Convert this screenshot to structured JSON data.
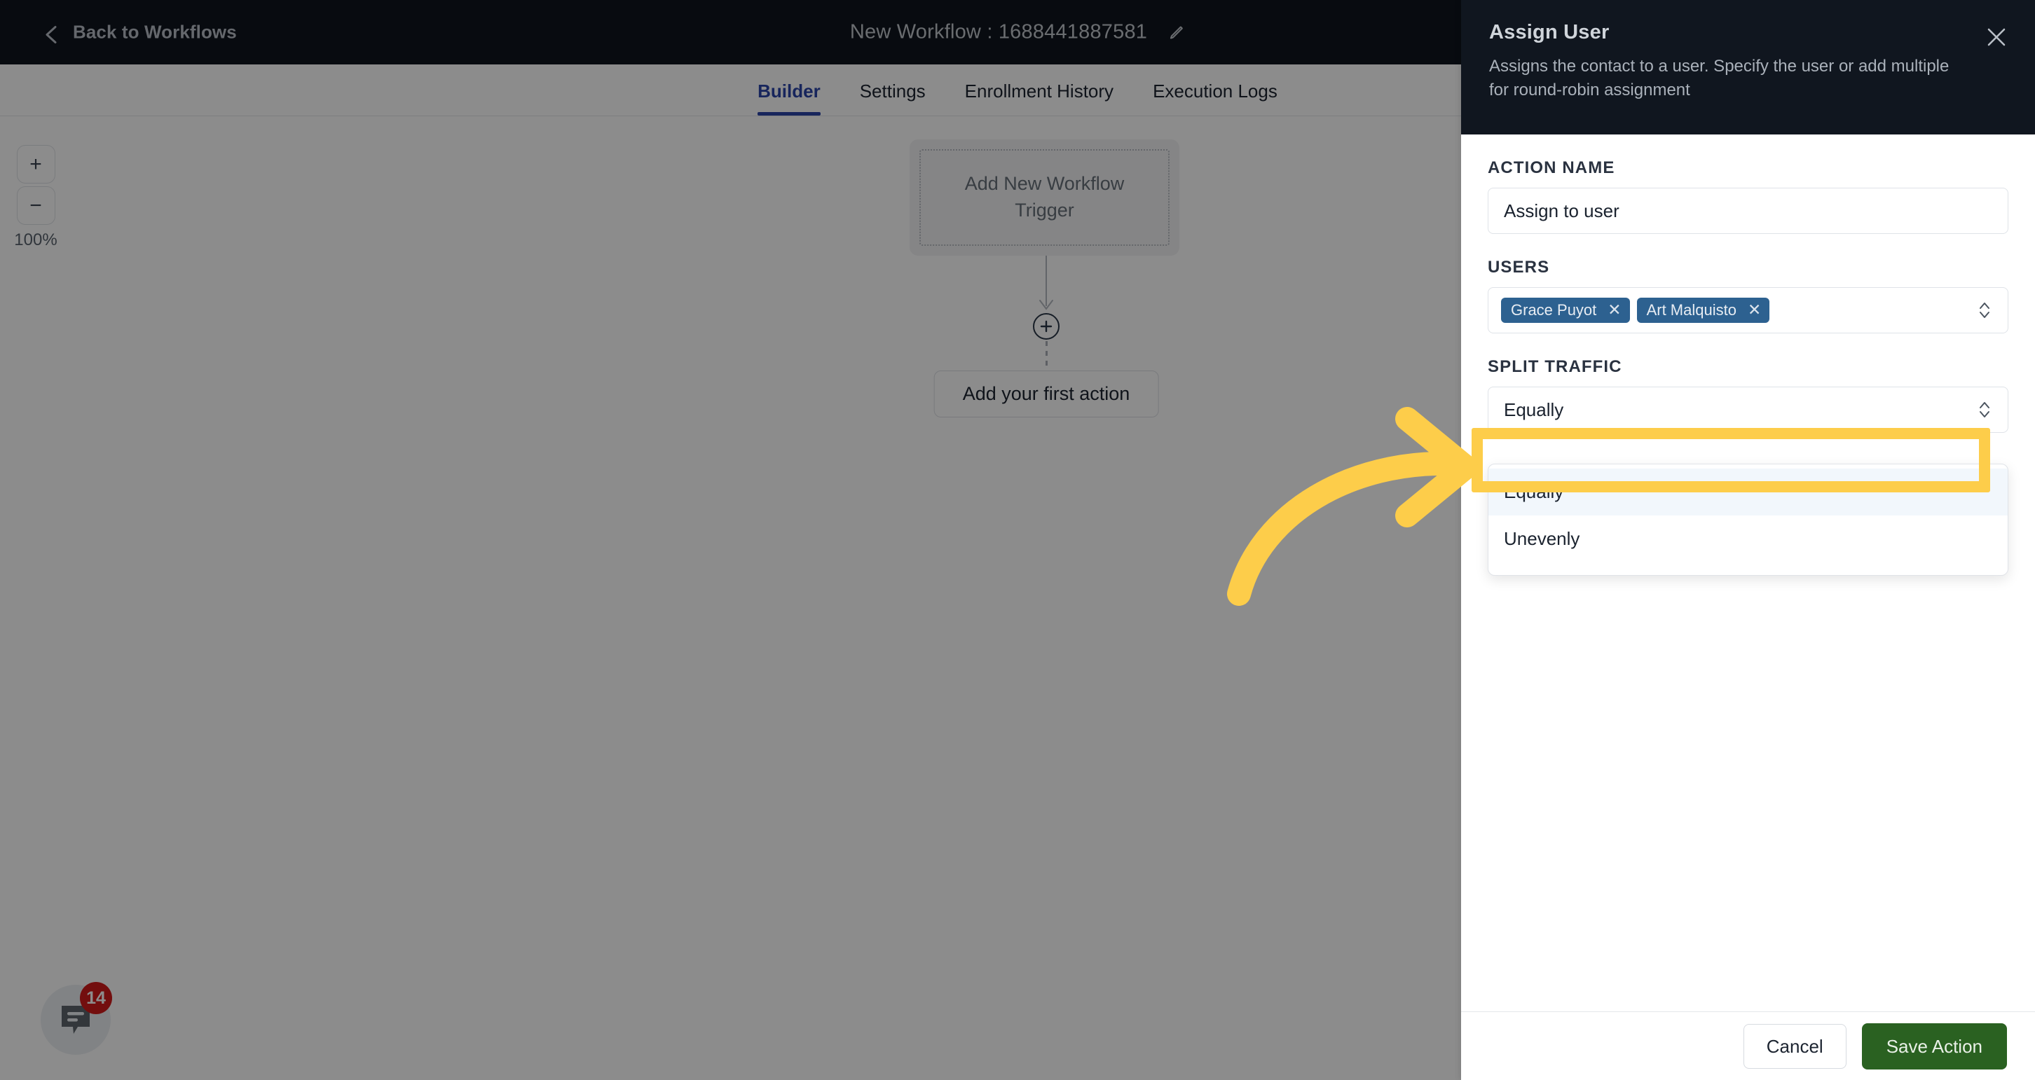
{
  "topbar": {
    "back_label": "Back to Workflows",
    "back_icon": "chevron-left-icon",
    "workflow_title": "New Workflow : 1688441887581",
    "edit_icon": "pencil-icon"
  },
  "tabs": [
    {
      "label": "Builder",
      "active": true
    },
    {
      "label": "Settings",
      "active": false
    },
    {
      "label": "Enrollment History",
      "active": false
    },
    {
      "label": "Execution Logs",
      "active": false
    }
  ],
  "canvas": {
    "zoom": {
      "in_label": "+",
      "out_label": "−",
      "level": "100%"
    },
    "trigger_card_label": "Add New Workflow Trigger",
    "add_node_icon": "plus-circle-icon",
    "first_action_label": "Add your first action",
    "chat": {
      "icon": "chat-bubble-icon",
      "badge": "14"
    }
  },
  "panel": {
    "title": "Assign User",
    "description": "Assigns the contact to a user. Specify the user or add multiple for round-robin assignment",
    "close_icon": "close-icon",
    "fields": {
      "action_name": {
        "label": "ACTION NAME",
        "value": "Assign to user"
      },
      "users": {
        "label": "USERS",
        "chips": [
          {
            "name": "Grace Puyot",
            "remove_icon": "close-icon"
          },
          {
            "name": "Art Malquisto",
            "remove_icon": "close-icon"
          }
        ],
        "selector_icon": "chevron-up-down-icon"
      },
      "split_traffic": {
        "label": "SPLIT TRAFFIC",
        "value": "Equally",
        "selector_icon": "chevron-up-down-icon",
        "open": true,
        "options": [
          {
            "label": "Equally",
            "highlighted": true
          },
          {
            "label": "Unevenly",
            "highlighted": false
          }
        ]
      }
    },
    "footer": {
      "cancel_label": "Cancel",
      "save_label": "Save Action"
    }
  },
  "annotation": {
    "highlight_color": "#fdcd4a",
    "arrow_icon": "curved-arrow-right-icon",
    "target": "Equally"
  }
}
